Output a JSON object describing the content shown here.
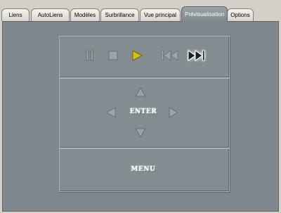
{
  "tabs": [
    {
      "label": "Liens",
      "active": false
    },
    {
      "label": "AutoLiens",
      "active": false
    },
    {
      "label": "Modèles",
      "active": false
    },
    {
      "label": "Surbrillance",
      "active": false
    },
    {
      "label": "Vue principal",
      "active": false
    },
    {
      "label": "Prévisualisation",
      "active": true
    },
    {
      "label": "Options",
      "active": false
    }
  ],
  "transport": {
    "pause_icon": "pause-icon",
    "stop_icon": "stop-icon",
    "play_icon": "play-icon",
    "prev_icon": "skip-back-icon",
    "next_icon": "skip-forward-icon"
  },
  "navigation": {
    "enter_label": "ENTER"
  },
  "menu": {
    "menu_label": "MENU"
  },
  "colors": {
    "panel": "#7e888c",
    "play_accent": "#d4c210",
    "active_tab": "#8a9498"
  }
}
